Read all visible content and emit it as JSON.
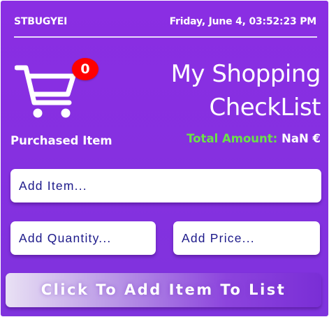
{
  "header": {
    "brand": "STBUGYEI",
    "datetime": "Friday, June 4, 03:52:23 PM"
  },
  "cart": {
    "icon": "shopping-cart-icon",
    "badge_count": "0",
    "label": "Purchased Item"
  },
  "title": {
    "line1": "My Shopping",
    "line2": "CheckList"
  },
  "total": {
    "label": "Total Amount:",
    "value": "NaN €"
  },
  "form": {
    "item_placeholder": "Add Item...",
    "quantity_placeholder": "Add Quantity...",
    "price_placeholder": "Add Price...",
    "submit_label": "Click To Add Item To List"
  },
  "colors": {
    "background": "#8a2ee3",
    "badge": "#ff0000",
    "total_label": "#6be049",
    "input_text": "#1d1a8a"
  }
}
